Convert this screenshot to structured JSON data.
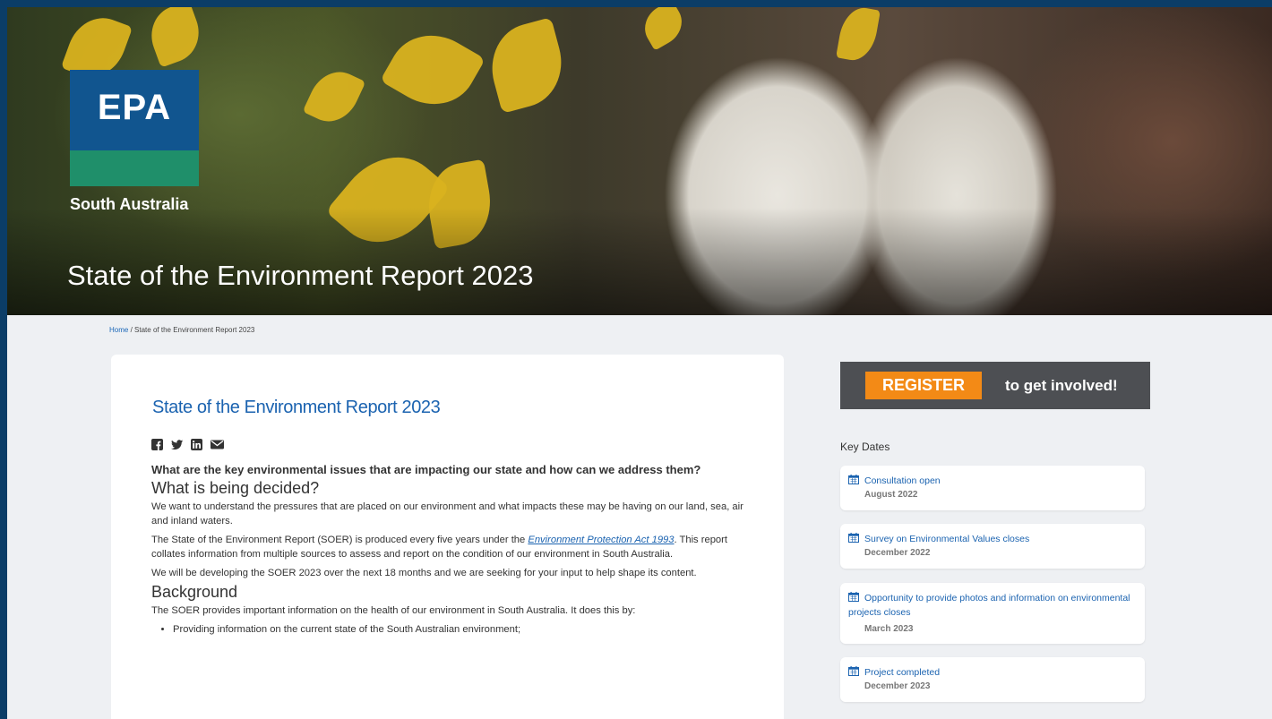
{
  "hero": {
    "logo": {
      "acronym": "EPA",
      "subtitle": "South Australia"
    },
    "title": "State of the Environment Report 2023"
  },
  "breadcrumb": {
    "home": "Home",
    "separator": "/",
    "current": "State of the Environment Report 2023"
  },
  "article": {
    "title": "State of the Environment Report 2023",
    "share_icons": [
      "facebook-icon",
      "twitter-icon",
      "linkedin-icon",
      "email-icon"
    ],
    "lead": "What are the key environmental issues that are impacting our state and how can we address them?",
    "heading1": "What is being decided?",
    "p1": "We want to understand the pressures that are placed on our environment and what impacts these may be having on our land, sea, air and inland waters.",
    "p2_before": "The State of the Environment Report (SOER) is produced every five years under the ",
    "p2_link": "Environment Protection Act 1993",
    "p2_after": ". This report collates information from multiple sources to assess and report on the condition of our environment in South Australia.",
    "p3": "We will be developing the SOER 2023 over the next 18 months and we are seeking for your input to help shape its content.",
    "heading2": "Background",
    "p4": "The SOER provides important information on the health of our environment in South Australia. It does this by:",
    "bullets": [
      "Providing information on the current state of the South Australian environment;"
    ]
  },
  "sidebar": {
    "register_label": "REGISTER",
    "register_tagline": "to get involved!",
    "key_dates_title": "Key Dates",
    "key_dates": [
      {
        "title": "Consultation open",
        "date": "August 2022"
      },
      {
        "title": "Survey on Environmental Values closes",
        "date": "December 2022"
      },
      {
        "title": "Opportunity to provide photos and information on environmental projects closes",
        "date": "March 2023"
      },
      {
        "title": "Project completed",
        "date": "December 2023"
      }
    ]
  },
  "colors": {
    "brand_blue": "#1b63b0",
    "register_orange": "#f38a16",
    "frame_navy": "#0b3d67"
  }
}
